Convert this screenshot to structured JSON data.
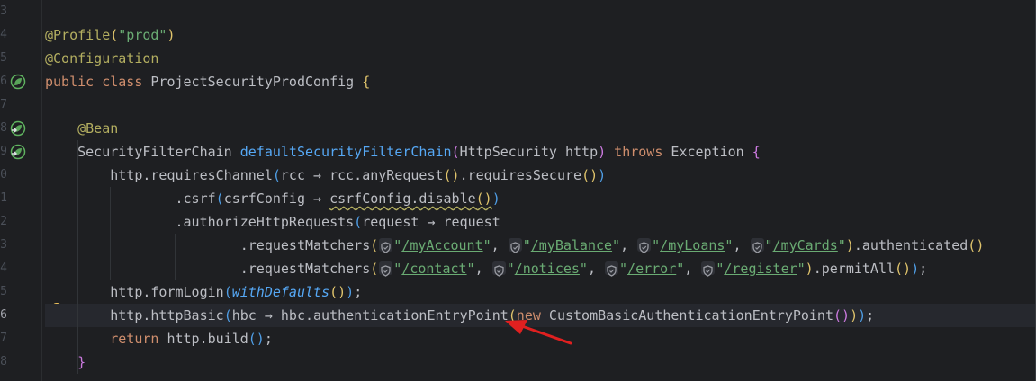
{
  "editor": {
    "line_numbers": [
      "3",
      "4",
      "5",
      "6",
      "7",
      "8",
      "9",
      "0",
      "1",
      "2",
      "3",
      "4",
      "5",
      "6",
      "7",
      "8"
    ],
    "current_line_index": 13,
    "lines": [
      {
        "tokens": []
      },
      {
        "tokens": [
          {
            "c": "ann",
            "t": "@Profile"
          },
          {
            "c": "paren-y",
            "t": "("
          },
          {
            "c": "str",
            "t": "\"prod\""
          },
          {
            "c": "paren-y",
            "t": ")"
          }
        ]
      },
      {
        "tokens": [
          {
            "c": "ann",
            "t": "@Configuration"
          }
        ]
      },
      {
        "tokens": [
          {
            "c": "kw",
            "t": "public class "
          },
          {
            "c": "pl",
            "t": "ProjectSecurityProdConfig "
          },
          {
            "c": "paren-y",
            "t": "{"
          }
        ]
      },
      {
        "tokens": []
      },
      {
        "tokens": [
          {
            "c": "pl",
            "t": "    "
          },
          {
            "c": "ann",
            "t": "@Bean"
          }
        ]
      },
      {
        "tokens": [
          {
            "c": "pl",
            "t": "    SecurityFilterChain "
          },
          {
            "c": "fn",
            "t": "defaultSecurityFilterChain"
          },
          {
            "c": "paren-p",
            "t": "("
          },
          {
            "c": "pl",
            "t": "HttpSecurity http"
          },
          {
            "c": "paren-p",
            "t": ")"
          },
          {
            "c": "kw",
            "t": " throws "
          },
          {
            "c": "pl",
            "t": "Exception "
          },
          {
            "c": "paren-p",
            "t": "{"
          }
        ]
      },
      {
        "tokens": [
          {
            "c": "pl",
            "t": "        http.requiresChannel"
          },
          {
            "c": "paren-b",
            "t": "("
          },
          {
            "c": "pl",
            "t": "rcc → rcc.anyRequest"
          },
          {
            "c": "paren-y",
            "t": "()"
          },
          {
            "c": "pl",
            "t": ".requiresSecure"
          },
          {
            "c": "paren-y",
            "t": "()"
          },
          {
            "c": "paren-b",
            "t": ")"
          }
        ]
      },
      {
        "tokens": [
          {
            "c": "pl",
            "t": "                .csrf"
          },
          {
            "c": "paren-b",
            "t": "("
          },
          {
            "c": "pl",
            "t": "csrfConfig → "
          },
          {
            "c": "pl squiggle",
            "t": "csrfConfig.disable"
          },
          {
            "c": "paren-y squiggle",
            "t": "()"
          },
          {
            "c": "paren-b",
            "t": ")"
          }
        ]
      },
      {
        "tokens": [
          {
            "c": "pl",
            "t": "                .authorizeHttpRequests"
          },
          {
            "c": "paren-b",
            "t": "("
          },
          {
            "c": "pl",
            "t": "request → request"
          }
        ]
      },
      {
        "tokens": [
          {
            "c": "pl",
            "t": "                        .requestMatchers"
          },
          {
            "c": "paren-y",
            "t": "("
          },
          {
            "c": "inlay",
            "t": ""
          },
          {
            "c": "str",
            "t": "\""
          },
          {
            "c": "link",
            "t": "/myAccount"
          },
          {
            "c": "str",
            "t": "\""
          },
          {
            "c": "pl",
            "t": ", "
          },
          {
            "c": "inlay",
            "t": ""
          },
          {
            "c": "str",
            "t": "\""
          },
          {
            "c": "link",
            "t": "/myBalance"
          },
          {
            "c": "str",
            "t": "\""
          },
          {
            "c": "pl",
            "t": ", "
          },
          {
            "c": "inlay",
            "t": ""
          },
          {
            "c": "str",
            "t": "\""
          },
          {
            "c": "link",
            "t": "/myLoans"
          },
          {
            "c": "str",
            "t": "\""
          },
          {
            "c": "pl",
            "t": ", "
          },
          {
            "c": "inlay",
            "t": ""
          },
          {
            "c": "str",
            "t": "\""
          },
          {
            "c": "link",
            "t": "/myCards"
          },
          {
            "c": "str",
            "t": "\""
          },
          {
            "c": "paren-y",
            "t": ")"
          },
          {
            "c": "pl",
            "t": ".authenticated"
          },
          {
            "c": "paren-y",
            "t": "()"
          }
        ]
      },
      {
        "tokens": [
          {
            "c": "pl",
            "t": "                        .requestMatchers"
          },
          {
            "c": "paren-y",
            "t": "("
          },
          {
            "c": "inlay",
            "t": ""
          },
          {
            "c": "str",
            "t": "\""
          },
          {
            "c": "link",
            "t": "/contact"
          },
          {
            "c": "str",
            "t": "\""
          },
          {
            "c": "pl",
            "t": ", "
          },
          {
            "c": "inlay",
            "t": ""
          },
          {
            "c": "str",
            "t": "\""
          },
          {
            "c": "link",
            "t": "/notices"
          },
          {
            "c": "str",
            "t": "\""
          },
          {
            "c": "pl",
            "t": ", "
          },
          {
            "c": "inlay",
            "t": ""
          },
          {
            "c": "str",
            "t": "\""
          },
          {
            "c": "link",
            "t": "/error"
          },
          {
            "c": "str",
            "t": "\""
          },
          {
            "c": "pl",
            "t": ", "
          },
          {
            "c": "inlay",
            "t": ""
          },
          {
            "c": "str",
            "t": "\""
          },
          {
            "c": "link",
            "t": "/register"
          },
          {
            "c": "str",
            "t": "\""
          },
          {
            "c": "paren-y",
            "t": ")"
          },
          {
            "c": "pl",
            "t": ".permitAll"
          },
          {
            "c": "paren-y",
            "t": "()"
          },
          {
            "c": "paren-b",
            "t": ")"
          },
          {
            "c": "pl",
            "t": ";"
          }
        ]
      },
      {
        "tokens": [
          {
            "c": "pl",
            "t": "        http.formLogin"
          },
          {
            "c": "paren-b",
            "t": "("
          },
          {
            "c": "ital",
            "t": "withDefaults"
          },
          {
            "c": "paren-y",
            "t": "()"
          },
          {
            "c": "paren-b",
            "t": ")"
          },
          {
            "c": "pl",
            "t": ";"
          }
        ]
      },
      {
        "tokens": [
          {
            "c": "pl",
            "t": "        http.httpBasic"
          },
          {
            "c": "paren-b",
            "t": "("
          },
          {
            "c": "pl",
            "t": "hbc → hbc.authenticationEntryPoint"
          },
          {
            "c": "paren-y",
            "t": "("
          },
          {
            "c": "kw",
            "t": "new "
          },
          {
            "c": "pl",
            "t": "CustomBasicAuthenticationEntryPoint"
          },
          {
            "c": "paren-p",
            "t": "()"
          },
          {
            "c": "paren-y",
            "t": ")"
          },
          {
            "c": "paren-b",
            "t": ")"
          },
          {
            "c": "pl",
            "t": ";"
          }
        ]
      },
      {
        "tokens": [
          {
            "c": "pl",
            "t": "        "
          },
          {
            "c": "kw",
            "t": "return "
          },
          {
            "c": "pl",
            "t": "http.build"
          },
          {
            "c": "paren-b",
            "t": "()"
          },
          {
            "c": "pl",
            "t": ";"
          }
        ]
      },
      {
        "tokens": [
          {
            "c": "pl",
            "t": "    "
          },
          {
            "c": "paren-p",
            "t": "}"
          }
        ]
      }
    ]
  },
  "gutter_icons": [
    {
      "line_index": 3,
      "icon": "spring-bean-icon"
    },
    {
      "line_index": 5,
      "icon": "spring-bean-navigate-icon"
    },
    {
      "line_index": 6,
      "icon": "spring-bean-navigate-icon"
    }
  ],
  "intention_icon": "lightbulb-icon",
  "annotation": {
    "icon": "red-arrow-icon",
    "color": "#e02020"
  },
  "colors": {
    "background": "#1e1f22",
    "keyword": "#cf8e6d",
    "annotation": "#b3ae60",
    "string": "#6aab73",
    "method_decl": "#56a8f5"
  }
}
